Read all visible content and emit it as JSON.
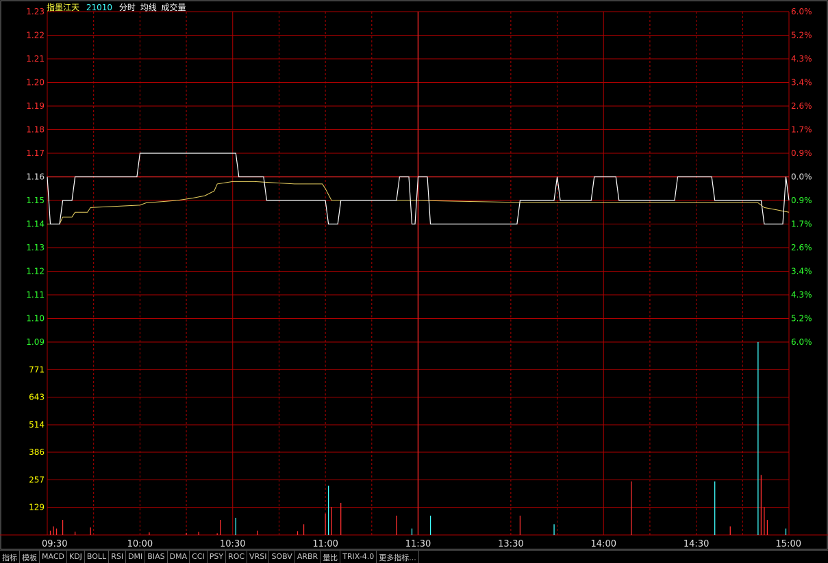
{
  "header": {
    "stock_name": "指墨江天",
    "code": "21010",
    "labels": [
      "分时",
      "均线",
      "成交量"
    ]
  },
  "colors": {
    "background": "#000000",
    "grid": "#b00000",
    "grid_major": "#d02020",
    "price_line": "#ffffff",
    "avg_line": "#e8d060",
    "up_text": "#ff3030",
    "down_text": "#30ff30",
    "neutral_text": "#e0e0e0",
    "volume_label": "#ffff00",
    "volume_up": "#ff3030",
    "volume_down": "#40ffff"
  },
  "tabs": [
    "指标",
    "模板",
    "MACD",
    "KDJ",
    "BOLL",
    "RSI",
    "DMI",
    "BIAS",
    "DMA",
    "CCI",
    "PSY",
    "ROC",
    "VRSI",
    "SOBV",
    "ARBR",
    "量比",
    "TRIX-4.0",
    "更多指标..."
  ],
  "chart_data": {
    "type": "line",
    "prev_close": 1.16,
    "price_axis": {
      "ticks": [
        1.23,
        1.22,
        1.21,
        1.2,
        1.19,
        1.18,
        1.17,
        1.16,
        1.15,
        1.14,
        1.13,
        1.12,
        1.11,
        1.1,
        1.09
      ],
      "tick_labels": [
        "1.23",
        "1.22",
        "1.21",
        "1.20",
        "1.19",
        "1.18",
        "1.17",
        "1.16",
        "1.15",
        "1.14",
        "1.13",
        "1.12",
        "1.11",
        "1.10",
        "1.09"
      ],
      "ylim": [
        1.09,
        1.23
      ]
    },
    "pct_axis": {
      "labels": [
        "6.0%",
        "5.2%",
        "4.3%",
        "3.4%",
        "2.6%",
        "1.7%",
        "0.9%",
        "0.0%",
        "0.9%",
        "1.7%",
        "2.6%",
        "3.4%",
        "4.3%",
        "5.2%",
        "6.0%"
      ]
    },
    "volume_axis": {
      "tick_labels": [
        "771",
        "643",
        "514",
        "386",
        "257",
        "129"
      ],
      "ticks": [
        771,
        643,
        514,
        386,
        257,
        129
      ],
      "ylim": [
        0,
        900
      ]
    },
    "x_axis": {
      "tick_labels": [
        "09:30",
        "10:00",
        "10:30",
        "11:00",
        "11:30",
        "13:30",
        "14:00",
        "14:30",
        "15:00"
      ],
      "tick_minutes": [
        0,
        30,
        60,
        90,
        120,
        150,
        180,
        210,
        240
      ]
    },
    "series": [
      {
        "key": "price",
        "points": [
          [
            0,
            1.16
          ],
          [
            1,
            1.14
          ],
          [
            4,
            1.14
          ],
          [
            5,
            1.15
          ],
          [
            8,
            1.15
          ],
          [
            9,
            1.16
          ],
          [
            29,
            1.16
          ],
          [
            30,
            1.17
          ],
          [
            61,
            1.17
          ],
          [
            62,
            1.16
          ],
          [
            70,
            1.16
          ],
          [
            71,
            1.15
          ],
          [
            90,
            1.15
          ],
          [
            91,
            1.14
          ],
          [
            94,
            1.14
          ],
          [
            95,
            1.15
          ],
          [
            113,
            1.15
          ],
          [
            114,
            1.16
          ],
          [
            117,
            1.16
          ],
          [
            118,
            1.14
          ],
          [
            119,
            1.14
          ],
          [
            120,
            1.16
          ],
          [
            123,
            1.16
          ],
          [
            124,
            1.14
          ],
          [
            152,
            1.14
          ],
          [
            153,
            1.15
          ],
          [
            164,
            1.15
          ],
          [
            165,
            1.16
          ],
          [
            166,
            1.15
          ],
          [
            176,
            1.15
          ],
          [
            177,
            1.16
          ],
          [
            184,
            1.16
          ],
          [
            185,
            1.15
          ],
          [
            203,
            1.15
          ],
          [
            204,
            1.16
          ],
          [
            215,
            1.16
          ],
          [
            216,
            1.15
          ],
          [
            231,
            1.15
          ],
          [
            232,
            1.14
          ],
          [
            238,
            1.14
          ],
          [
            239,
            1.16
          ],
          [
            240,
            1.15
          ]
        ]
      },
      {
        "key": "avg",
        "points": [
          [
            0,
            1.14
          ],
          [
            4,
            1.14
          ],
          [
            5,
            1.143
          ],
          [
            8,
            1.143
          ],
          [
            9,
            1.145
          ],
          [
            13,
            1.145
          ],
          [
            14,
            1.147
          ],
          [
            30,
            1.148
          ],
          [
            32,
            1.149
          ],
          [
            37,
            1.1495
          ],
          [
            42,
            1.15
          ],
          [
            47,
            1.151
          ],
          [
            51,
            1.152
          ],
          [
            54,
            1.154
          ],
          [
            55,
            1.157
          ],
          [
            60,
            1.158
          ],
          [
            67,
            1.158
          ],
          [
            80,
            1.157
          ],
          [
            89,
            1.157
          ],
          [
            90,
            1.155
          ],
          [
            92,
            1.15
          ],
          [
            113,
            1.15
          ],
          [
            120,
            1.15
          ],
          [
            160,
            1.149
          ],
          [
            200,
            1.149
          ],
          [
            230,
            1.149
          ],
          [
            232,
            1.147
          ],
          [
            236,
            1.146
          ],
          [
            240,
            1.145
          ]
        ]
      }
    ],
    "volume": [
      [
        1,
        20,
        "u"
      ],
      [
        2,
        40,
        "u"
      ],
      [
        3,
        30,
        "u"
      ],
      [
        5,
        70,
        "u"
      ],
      [
        9,
        15,
        "u"
      ],
      [
        14,
        35,
        "u"
      ],
      [
        33,
        12,
        "u"
      ],
      [
        45,
        10,
        "u"
      ],
      [
        49,
        14,
        "u"
      ],
      [
        55,
        8,
        "u"
      ],
      [
        56,
        70,
        "u"
      ],
      [
        61,
        80,
        "d"
      ],
      [
        68,
        20,
        "u"
      ],
      [
        81,
        18,
        "u"
      ],
      [
        83,
        50,
        "u"
      ],
      [
        90,
        100,
        "u"
      ],
      [
        91,
        230,
        "d"
      ],
      [
        92,
        130,
        "u"
      ],
      [
        95,
        150,
        "u"
      ],
      [
        113,
        90,
        "u"
      ],
      [
        118,
        30,
        "d"
      ],
      [
        124,
        90,
        "d"
      ],
      [
        153,
        90,
        "u"
      ],
      [
        164,
        50,
        "d"
      ],
      [
        189,
        250,
        "u"
      ],
      [
        216,
        250,
        "d"
      ],
      [
        221,
        40,
        "u"
      ],
      [
        230,
        1000,
        "d"
      ],
      [
        231,
        280,
        "u"
      ],
      [
        232,
        130,
        "u"
      ],
      [
        233,
        70,
        "u"
      ],
      [
        239,
        30,
        "d"
      ]
    ]
  }
}
